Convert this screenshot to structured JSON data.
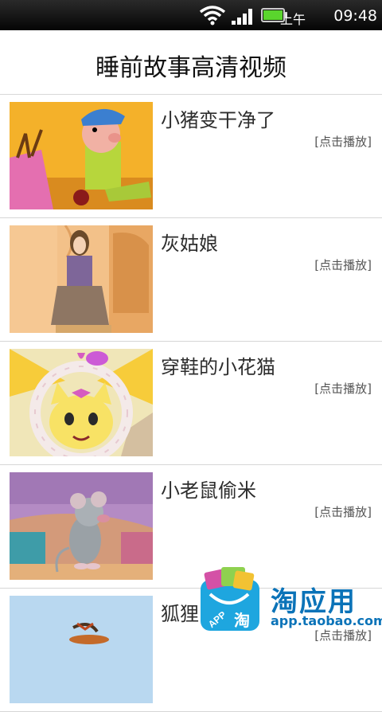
{
  "status": {
    "ampm": "上午",
    "time": "09:48"
  },
  "header": {
    "title": "睡前故事高清视频"
  },
  "items": [
    {
      "title": "小猪变干净了",
      "action": "[点击播放]"
    },
    {
      "title": "灰姑娘",
      "action": "[点击播放]"
    },
    {
      "title": "穿鞋的小花猫",
      "action": "[点击播放]"
    },
    {
      "title": "小老鼠偷米",
      "action": "[点击播放]"
    },
    {
      "title": "狐狸",
      "action": "[点击播放]"
    }
  ],
  "ad": {
    "brand": "淘应用",
    "url": "app.taobao.com",
    "bag_text": "APP",
    "bag_char": "淘"
  },
  "colors": {
    "accent": "#0b73b8",
    "statusbar": "#111111"
  }
}
